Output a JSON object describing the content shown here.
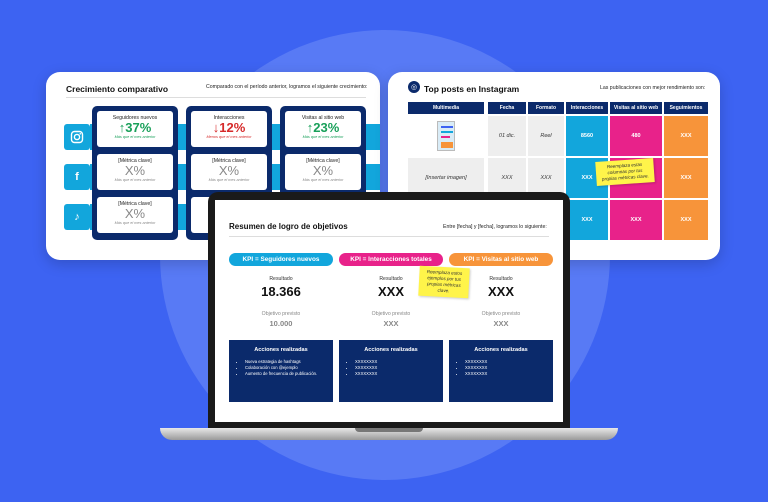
{
  "colors": {
    "background": "#3d63f2",
    "navy": "#0b2a6b",
    "cyan": "#12a6dc",
    "pink": "#e8228a",
    "orange": "#f7943a",
    "green": "#19a05a",
    "red": "#d62a2a",
    "sticky": "#fff44a"
  },
  "left_card": {
    "title": "Crecimiento comparativo",
    "subtitle": "Comparado con el período anterior, logramos el siguiente crecimiento:",
    "social_icons": [
      "instagram-icon",
      "facebook-icon",
      "tiktok-icon"
    ],
    "columns": [
      {
        "cells": [
          {
            "label": "Seguidores nuevos",
            "value": "↑37%",
            "trend": "up",
            "note": "Más que el mes anterior"
          },
          {
            "label": "[Métrica clave]",
            "value": "X%",
            "trend": "neutral",
            "note": "Más que el mes anterior"
          },
          {
            "label": "[Métrica clave]",
            "value": "X%",
            "trend": "neutral",
            "note": "Más que el mes anterior"
          }
        ]
      },
      {
        "cells": [
          {
            "label": "Interacciones",
            "value": "↓12%",
            "trend": "down",
            "note": "Menos que el mes anterior"
          },
          {
            "label": "[Métrica clave]",
            "value": "X%",
            "trend": "neutral",
            "note": "Más que el mes anterior"
          },
          {
            "label": "[Métrica clave]",
            "value": "X%",
            "trend": "neutral",
            "note": "Más que el mes anterior"
          }
        ]
      },
      {
        "cells": [
          {
            "label": "Visitas al sitio web",
            "value": "↑23%",
            "trend": "up",
            "note": "Más que el mes anterior"
          },
          {
            "label": "[Métrica clave]",
            "value": "X%",
            "trend": "neutral",
            "note": "Más que el mes anterior"
          },
          {
            "label": "",
            "value": "",
            "trend": "neutral",
            "note": ""
          }
        ]
      }
    ]
  },
  "right_card": {
    "title": "Top posts en Instagram",
    "subtitle": "Las publicaciones con mejor rendimiento son:",
    "headers": [
      "Multimedia",
      "Fecha",
      "Formato",
      "Interacciones",
      "Visitas al sitio web",
      "Seguimientos"
    ],
    "rows": [
      [
        "",
        "01 dic.",
        "Reel",
        "8560",
        "480",
        "XXX"
      ],
      [
        "[Insertar imagen]",
        "XXX",
        "XXX",
        "XXX",
        "XXX",
        "XXX"
      ],
      [
        "",
        "",
        "",
        "XXX",
        "XXX",
        "XXX"
      ]
    ],
    "sticky_note": "Reemplaza estas columnas por tus propias métricas clave."
  },
  "laptop_slide": {
    "title": "Resumen de logro de objetivos",
    "subtitle": "Entre [fecha] y [fecha], logramos lo siguiente:",
    "kpis": [
      {
        "label": "KPI = Seguidores nuevos",
        "result_label": "Resultado",
        "result": "18.366",
        "target_label": "Objetivo previsto",
        "target": "10.000",
        "actions_title": "Acciones realizadas",
        "actions": [
          "Nueva estrategia de hashtags",
          "Colaboración con @ejemplo",
          "Aumento de frecuencia de publicación."
        ]
      },
      {
        "label": "KPI = Interacciones totales",
        "result_label": "Resultado",
        "result": "XXX",
        "target_label": "Objetivo previsto",
        "target": "XXX",
        "actions_title": "Acciones realizadas",
        "actions": [
          "XXXXXXXX",
          "XXXXXXXX",
          "XXXXXXXX"
        ]
      },
      {
        "label": "KPI = Visitas al sitio web",
        "result_label": "Resultado",
        "result": "XXX",
        "target_label": "Objetivo previsto",
        "target": "XXX",
        "actions_title": "Acciones realizadas",
        "actions": [
          "XXXXXXXX",
          "XXXXXXXX",
          "XXXXXXXX"
        ]
      }
    ],
    "sticky_note": "Reemplaza estos ejemplos por tus propias métricas clave."
  }
}
